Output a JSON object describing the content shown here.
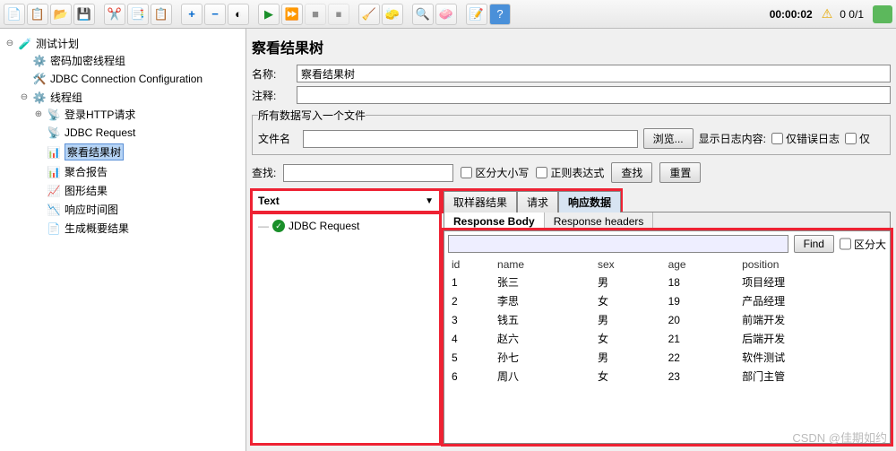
{
  "toolbar": {
    "time": "00:00:02",
    "counter": "0  0/1"
  },
  "tree": {
    "root": "测试计划",
    "n1": "密码加密线程组",
    "n2": "JDBC Connection Configuration",
    "n3": "线程组",
    "n3_1": "登录HTTP请求",
    "n3_2": "JDBC Request",
    "n3_3": "察看结果树",
    "n3_4": "聚合报告",
    "n3_5": "图形结果",
    "n3_6": "响应时间图",
    "n3_7": "生成概要结果"
  },
  "panel": {
    "title": "察看结果树",
    "name_label": "名称:",
    "name_value": "察看结果树",
    "comment_label": "注释:",
    "comment_value": "",
    "file_legend": "所有数据写入一个文件",
    "filename_label": "文件名",
    "filename_value": "",
    "browse": "浏览...",
    "show_log_label": "显示日志内容:",
    "error_only": "仅错误日志",
    "success_only": "仅",
    "search_label": "查找:",
    "search_value": "",
    "case_sensitive": "区分大小写",
    "regex": "正则表达式",
    "search_btn": "查找",
    "reset_btn": "重置"
  },
  "results": {
    "selector": "Text",
    "sampler": "JDBC Request",
    "tabs": {
      "t1": "取样器结果",
      "t2": "请求",
      "t3": "响应数据"
    },
    "subtabs": {
      "s1": "Response Body",
      "s2": "Response headers"
    },
    "find": "Find",
    "case": "区分大",
    "headers": [
      "id",
      "name",
      "sex",
      "age",
      "position"
    ],
    "rows": [
      [
        "1",
        "张三",
        "男",
        "18",
        "项目经理"
      ],
      [
        "2",
        "李思",
        "女",
        "19",
        "产品经理"
      ],
      [
        "3",
        "钱五",
        "男",
        "20",
        "前端开发"
      ],
      [
        "4",
        "赵六",
        "女",
        "21",
        "后端开发"
      ],
      [
        "5",
        "孙七",
        "男",
        "22",
        "软件测试"
      ],
      [
        "6",
        "周八",
        "女",
        "23",
        "部门主管"
      ]
    ]
  },
  "watermark": "CSDN @佳期如约"
}
